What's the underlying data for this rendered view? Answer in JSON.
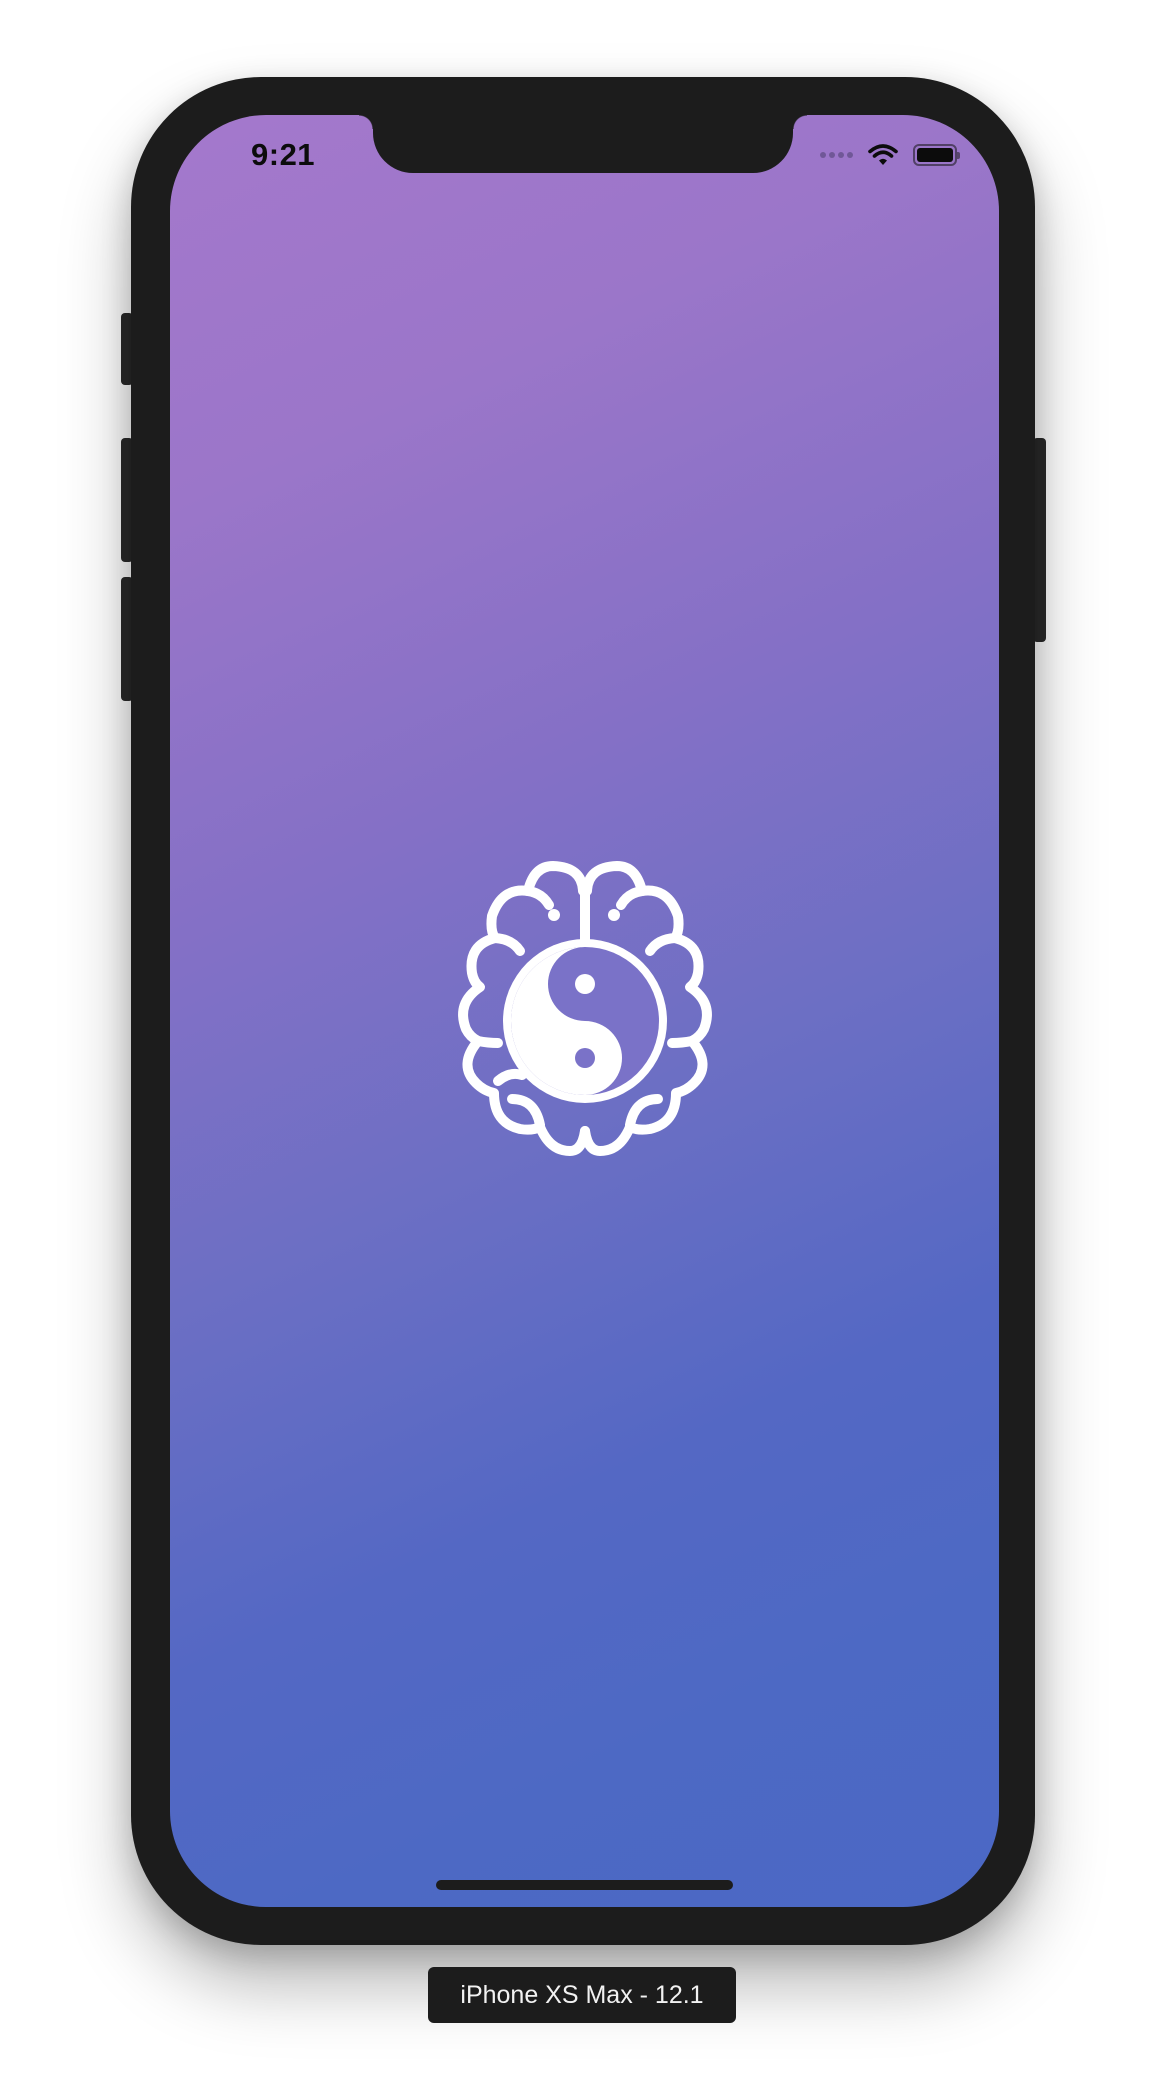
{
  "status_bar": {
    "time": "9:21",
    "wifi_icon": "wifi-icon",
    "signal_icon": "cellular-signal-icon",
    "battery_icon": "battery-icon",
    "battery_level": 1.0
  },
  "app": {
    "logo_icon": "brain-yin-yang-icon",
    "background_gradient": [
      "#a478cc",
      "#4b68c5"
    ],
    "logo_color": "#ffffff"
  },
  "simulator": {
    "device_label": "iPhone XS Max - 12.1"
  }
}
